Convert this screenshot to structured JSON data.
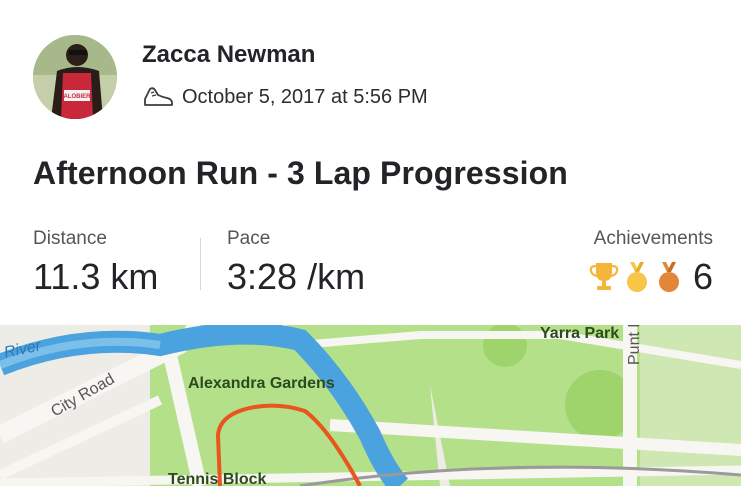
{
  "athlete": {
    "name": "Zacca Newman",
    "bib_text": "ALOBIER"
  },
  "activity": {
    "date_time": "October 5, 2017 at 5:56 PM",
    "title": "Afternoon Run - 3 Lap Progression",
    "type_icon": "shoe-icon"
  },
  "stats": {
    "distance": {
      "label": "Distance",
      "value": "11.3 km"
    },
    "pace": {
      "label": "Pace",
      "value": "3:28 /km"
    },
    "achievements": {
      "label": "Achievements",
      "count": "6",
      "icons": [
        "trophy-icon",
        "gold-medal-icon",
        "bronze-medal-icon"
      ]
    }
  },
  "map": {
    "labels": {
      "river": "River",
      "city_road": "City Road",
      "alexandra_gardens": "Alexandra Gardens",
      "yarra_park": "Yarra Park",
      "punt_rd": "Punt Rd",
      "tennis_block": "Tennis Block"
    },
    "colors": {
      "park": "#b5e08a",
      "water": "#4aa3df",
      "route": "#e8551d",
      "road": "#f1efe8"
    }
  }
}
